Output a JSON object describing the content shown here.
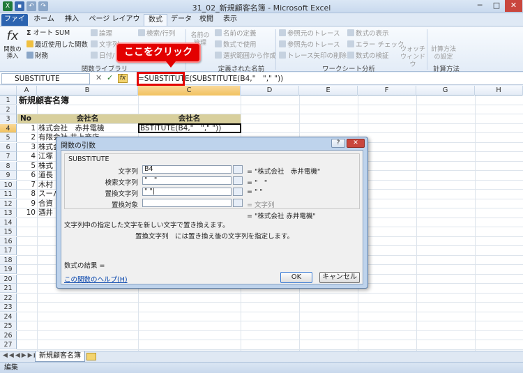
{
  "window": {
    "title": "31_02_新規顧客名簿 - Microsoft Excel",
    "minimize": "─",
    "maximize": "□",
    "close": "✕"
  },
  "ribbon_tabs": [
    "ファイル",
    "ホーム",
    "挿入",
    "ページ レイアウト",
    "数式",
    "データ",
    "校閲",
    "表示"
  ],
  "ribbon": {
    "insert_function": "関数の挿入",
    "autosum": "オート SUM",
    "recent": "最近使用した関数",
    "financial": "財務",
    "logical": "論理",
    "text": "文字列",
    "datetime": "日付/",
    "lookup": "検索/行列",
    "library_label": "関数ライブラリ",
    "name_manager": "名前の管理",
    "define_name": "名前の定義",
    "use_in_formula": "数式で使用",
    "create_from_selection": "選択範囲から作成",
    "defined_names_label": "定義された名前",
    "trace_precedents": "参照元のトレース",
    "trace_dependents": "参照先のトレース",
    "remove_arrows": "トレース矢印の削除",
    "show_formulas": "数式の表示",
    "error_check": "エラー チェック",
    "evaluate": "数式の検証",
    "watch_window": "ウォッチ ウィンドウ",
    "audit_label": "ワークシート分析",
    "calc_options": "計算方法の設定",
    "calc_label": "計算方法"
  },
  "formula_bar": {
    "name_box": "SUBSTITUTE",
    "formula": "=SUBSTITUTE(SUBSTITUTE(B4,\"　\",\" \"))"
  },
  "callout": "ここをクリック",
  "columns": [
    "A",
    "B",
    "C",
    "D",
    "E",
    "F",
    "G",
    "H"
  ],
  "rows": [
    "1",
    "2",
    "3",
    "4",
    "5",
    "6",
    "7",
    "8",
    "9",
    "10",
    "11",
    "12",
    "13",
    "14",
    "15",
    "16",
    "17",
    "18",
    "19",
    "20",
    "21",
    "22",
    "23",
    "24",
    "25",
    "26",
    "27"
  ],
  "sheet": {
    "title": "新規顧客名簿",
    "header_no": "No",
    "header_b": "会社名",
    "header_c": "会社名",
    "c4": "BSTITUTE(B4,\"　\",\" \"))",
    "nums": [
      "1",
      "2",
      "3",
      "4",
      "5",
      "6",
      "7",
      "8",
      "9",
      "10"
    ],
    "names": [
      "株式会社　赤井電機",
      "有限会社 井上商店",
      "株式会",
      "江塚",
      "株式",
      "道長",
      "木村",
      "スーパ",
      "合資",
      "酒井"
    ]
  },
  "sheet_tab": "新規顧客名簿",
  "status": "編集",
  "dialog": {
    "title": "関数の引数",
    "help_btn": "?",
    "close_btn": "✕",
    "function": "SUBSTITUTE",
    "arg1_label": "文字列",
    "arg1_value": "B4",
    "arg1_result": "= \"株式会社　赤井電機\"",
    "arg2_label": "検索文字列",
    "arg2_value": "\"　\"",
    "arg2_result": "= \"　\"",
    "arg3_label": "置換文字列",
    "arg3_value": "\" \"|",
    "arg3_result": "= \" \"",
    "arg4_label": "置換対象",
    "arg4_value": "",
    "arg4_result": "= 文字列",
    "total_result": "= \"株式会社 赤井電機\"",
    "description": "文字列中の指定した文字を新しい文字で置き換えます。",
    "arg_description": "置換文字列　には置き換え後の文字列を指定します。",
    "formula_result": "数式の結果 =",
    "help_link": "この関数のヘルプ(H)",
    "ok": "OK",
    "cancel": "キャンセル"
  }
}
